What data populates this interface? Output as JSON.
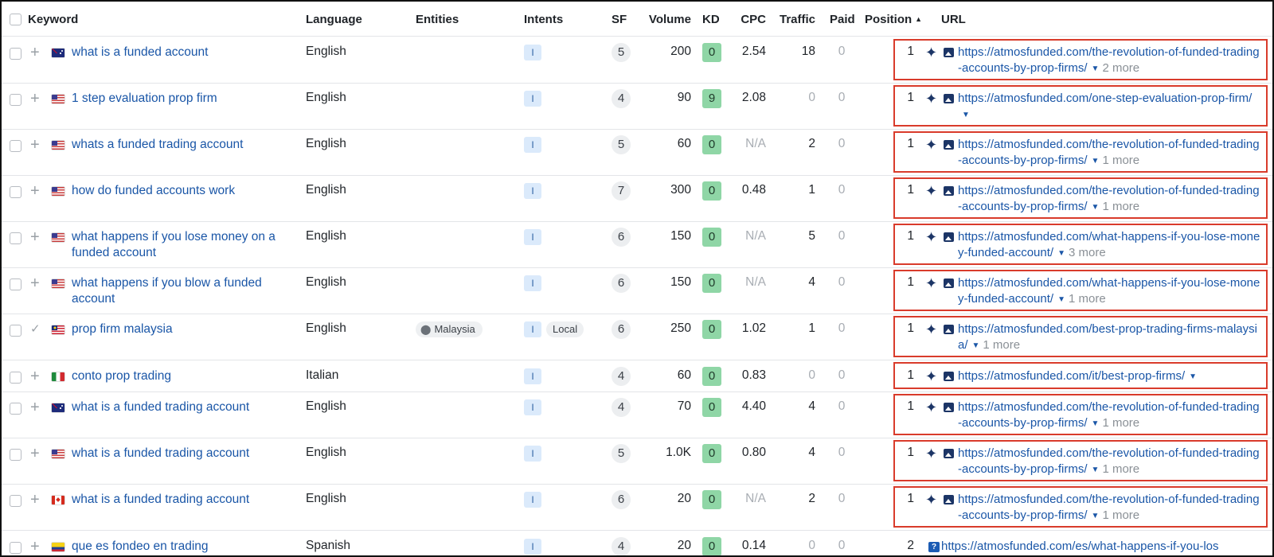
{
  "header": {
    "keyword": "Keyword",
    "language": "Language",
    "entities": "Entities",
    "intents": "Intents",
    "sf": "SF",
    "volume": "Volume",
    "kd": "KD",
    "cpc": "CPC",
    "traffic": "Traffic",
    "paid": "Paid",
    "position": "Position",
    "url": "URL"
  },
  "colors": {
    "link": "#1a56a7",
    "kd_green": "#8fd6a6",
    "highlight_border": "#d93b2b",
    "intent_bg": "#dbeafb"
  },
  "rows": [
    {
      "flag": "flag-au",
      "keyword": "what is a funded account",
      "language": "English",
      "intent": "I",
      "sf": "5",
      "volume": "200",
      "kd": "0",
      "cpc": "2.54",
      "traffic": "18",
      "paid": "0",
      "position": "1",
      "url": "https://atmosfunded.com/the-revolution-of-funded-trading-accounts-by-prop-firms/",
      "more": "2 more"
    },
    {
      "flag": "flag-us",
      "keyword": "1 step evaluation prop firm",
      "language": "English",
      "intent": "I",
      "sf": "4",
      "volume": "90",
      "kd": "9",
      "cpc": "2.08",
      "traffic": "0",
      "paid": "0",
      "position": "1",
      "url": "https://atmosfunded.com/one-step-evaluation-prop-firm/",
      "more": ""
    },
    {
      "flag": "flag-us",
      "keyword": "whats a funded trading account",
      "language": "English",
      "intent": "I",
      "sf": "5",
      "volume": "60",
      "kd": "0",
      "cpc": "N/A",
      "traffic": "2",
      "paid": "0",
      "position": "1",
      "url": "https://atmosfunded.com/the-revolution-of-funded-trading-accounts-by-prop-firms/",
      "more": "1 more"
    },
    {
      "flag": "flag-us",
      "keyword": "how do funded accounts work",
      "language": "English",
      "intent": "I",
      "sf": "7",
      "volume": "300",
      "kd": "0",
      "cpc": "0.48",
      "traffic": "1",
      "paid": "0",
      "position": "1",
      "url": "https://atmosfunded.com/the-revolution-of-funded-trading-accounts-by-prop-firms/",
      "more": "1 more"
    },
    {
      "flag": "flag-us",
      "keyword": "what happens if you lose money on a funded account",
      "language": "English",
      "intent": "I",
      "sf": "6",
      "volume": "150",
      "kd": "0",
      "cpc": "N/A",
      "traffic": "5",
      "paid": "0",
      "position": "1",
      "url": "https://atmosfunded.com/what-happens-if-you-lose-money-funded-account/",
      "more": "3 more"
    },
    {
      "flag": "flag-us",
      "keyword": "what happens if you blow a funded account",
      "language": "English",
      "intent": "I",
      "sf": "6",
      "volume": "150",
      "kd": "0",
      "cpc": "N/A",
      "traffic": "4",
      "paid": "0",
      "position": "1",
      "url": "https://atmosfunded.com/what-happens-if-you-lose-money-funded-account/",
      "more": "1 more"
    },
    {
      "flag": "flag-my",
      "keyword": "prop firm malaysia",
      "language": "English",
      "entity": "Malaysia",
      "intent": "I",
      "local": "Local",
      "sf": "6",
      "volume": "250",
      "kd": "0",
      "cpc": "1.02",
      "traffic": "1",
      "paid": "0",
      "position": "1",
      "url": "https://atmosfunded.com/best-prop-trading-firms-malaysia/",
      "more": "1 more"
    },
    {
      "flag": "flag-it",
      "keyword": "conto prop trading",
      "language": "Italian",
      "intent": "I",
      "sf": "4",
      "volume": "60",
      "kd": "0",
      "cpc": "0.83",
      "traffic": "0",
      "paid": "0",
      "position": "1",
      "url": "https://atmosfunded.com/it/best-prop-firms/",
      "more": ""
    },
    {
      "flag": "flag-au",
      "keyword": "what is a funded trading account",
      "language": "English",
      "intent": "I",
      "sf": "4",
      "volume": "70",
      "kd": "0",
      "cpc": "4.40",
      "traffic": "4",
      "paid": "0",
      "position": "1",
      "url": "https://atmosfunded.com/the-revolution-of-funded-trading-accounts-by-prop-firms/",
      "more": "1 more"
    },
    {
      "flag": "flag-us",
      "keyword": "what is a funded trading account",
      "language": "English",
      "intent": "I",
      "sf": "5",
      "volume": "1.0K",
      "kd": "0",
      "cpc": "0.80",
      "traffic": "4",
      "paid": "0",
      "position": "1",
      "url": "https://atmosfunded.com/the-revolution-of-funded-trading-accounts-by-prop-firms/",
      "more": "1 more"
    },
    {
      "flag": "flag-ca",
      "keyword": "what is a funded trading account",
      "language": "English",
      "intent": "I",
      "sf": "6",
      "volume": "20",
      "kd": "0",
      "cpc": "N/A",
      "traffic": "2",
      "paid": "0",
      "position": "1",
      "url": "https://atmosfunded.com/the-revolution-of-funded-trading-accounts-by-prop-firms/",
      "more": "1 more"
    },
    {
      "flag": "flag-co",
      "keyword": "que es fondeo en trading",
      "language": "Spanish",
      "intent": "I",
      "sf": "4",
      "volume": "20",
      "kd": "0",
      "cpc": "0.14",
      "traffic": "0",
      "paid": "0",
      "position": "2",
      "url": "https://atmosfunded.com/es/what-happens-if-you-los",
      "more": ""
    }
  ]
}
